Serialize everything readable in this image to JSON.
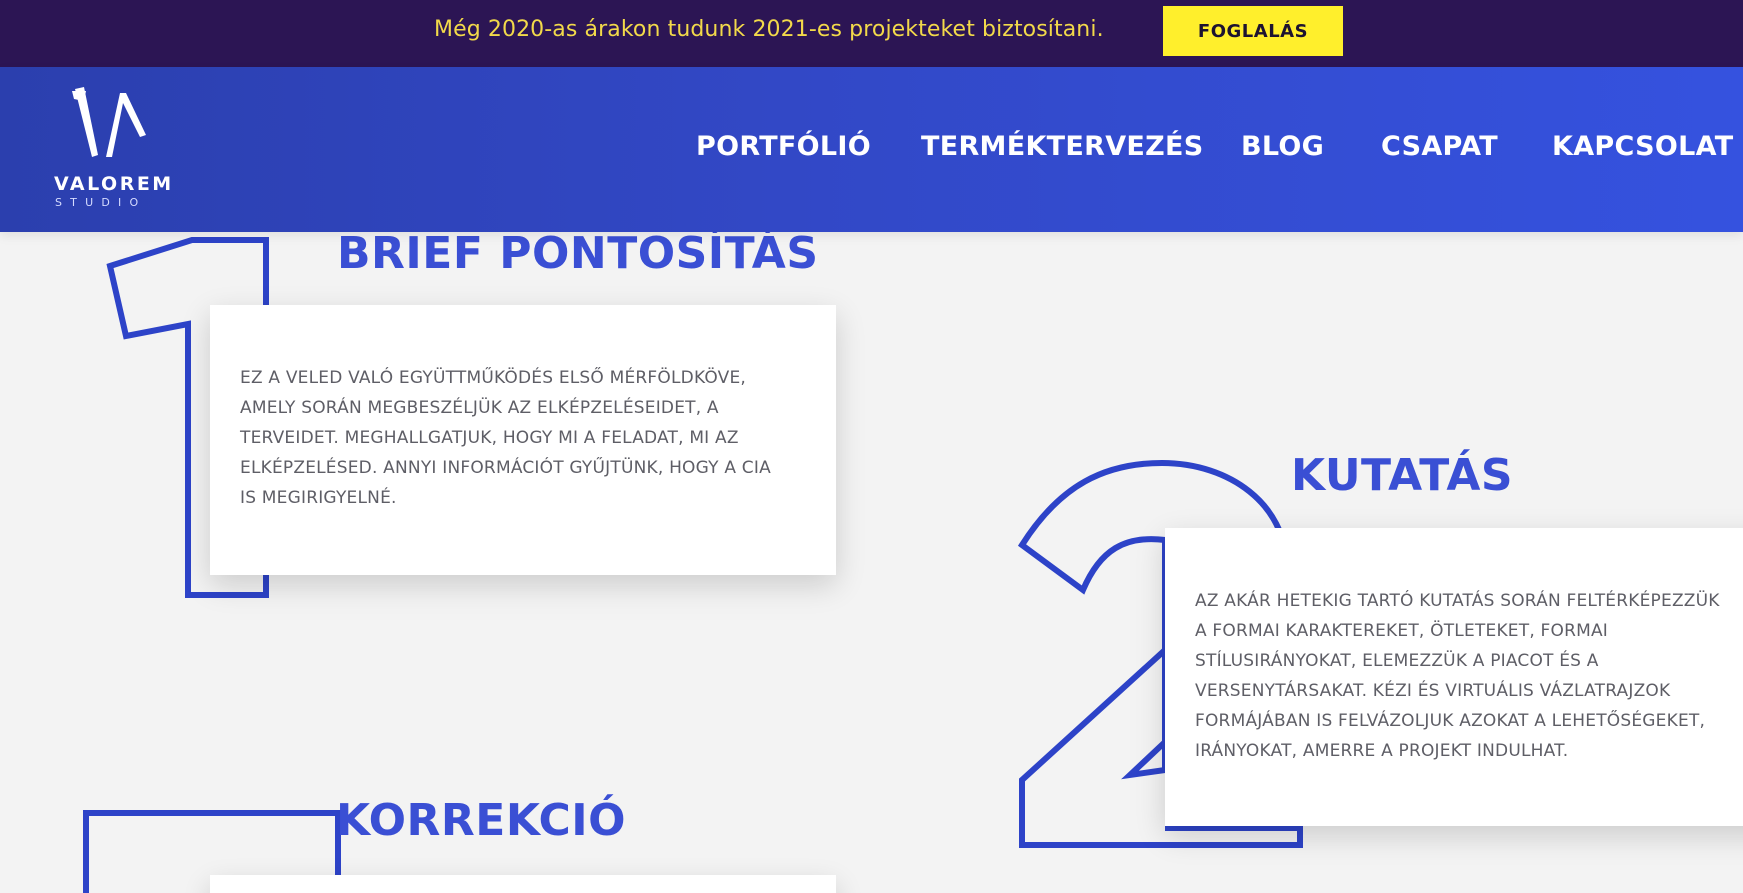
{
  "promo": {
    "text": "Még 2020-as árakon tudunk 2021-es projekteket biztosítani.",
    "button_label": "FOGLALÁS"
  },
  "brand": {
    "name": "VALOREM",
    "sub": "STUDIO"
  },
  "nav": {
    "items": [
      "PORTFÓLIÓ",
      "TERMÉKTERVEZÉS",
      "BLOG",
      "CSAPAT",
      "KAPCSOLAT"
    ]
  },
  "steps": [
    {
      "title": "BRIEF PONTOSÍTÁS",
      "lines": [
        "EZ A VELED VALÓ EGYÜTTMŰKÖDÉS ELSŐ MÉRFÖLDKÖVE,",
        "AMELY SORÁN MEGBESZÉLJÜK AZ ELKÉPZELÉSEIDET, A",
        "TERVEIDET. MEGHALLGATJUK, HOGY MI A FELADAT, MI AZ",
        "ELKÉPZELÉSED. ANNYI INFORMÁCIÓT GYŰJTÜNK, HOGY A CIA",
        "IS MEGIRIGYELNÉ."
      ]
    },
    {
      "title": "KUTATÁS",
      "lines": [
        "AZ AKÁR HETEKIG TARTÓ KUTATÁS SORÁN FELTÉRKÉPEZZÜK",
        "A FORMAI KARAKTEREKET, ÖTLETEKET, FORMAI",
        "STÍLUSIRÁNYOKAT, ELEMEZZÜK A PIACOT ÉS A",
        "VERSENYTÁRSAKAT. KÉZI ÉS VIRTUÁLIS VÁZLATRAJZOK",
        "FORMÁJÁBAN IS FELVÁZOLJUK AZOKAT A LEHETŐSÉGEKET,",
        "IRÁNYOKAT, AMERRE A PROJEKT INDULHAT."
      ]
    },
    {
      "title": "KORREKCIÓ",
      "lines": []
    }
  ],
  "colors": {
    "accent": "#3a4fd4",
    "numeral_stroke": "#2d43c8",
    "promo_bg": "#2c1554",
    "promo_text": "#f2d94a",
    "promo_button": "#ffef2c"
  }
}
